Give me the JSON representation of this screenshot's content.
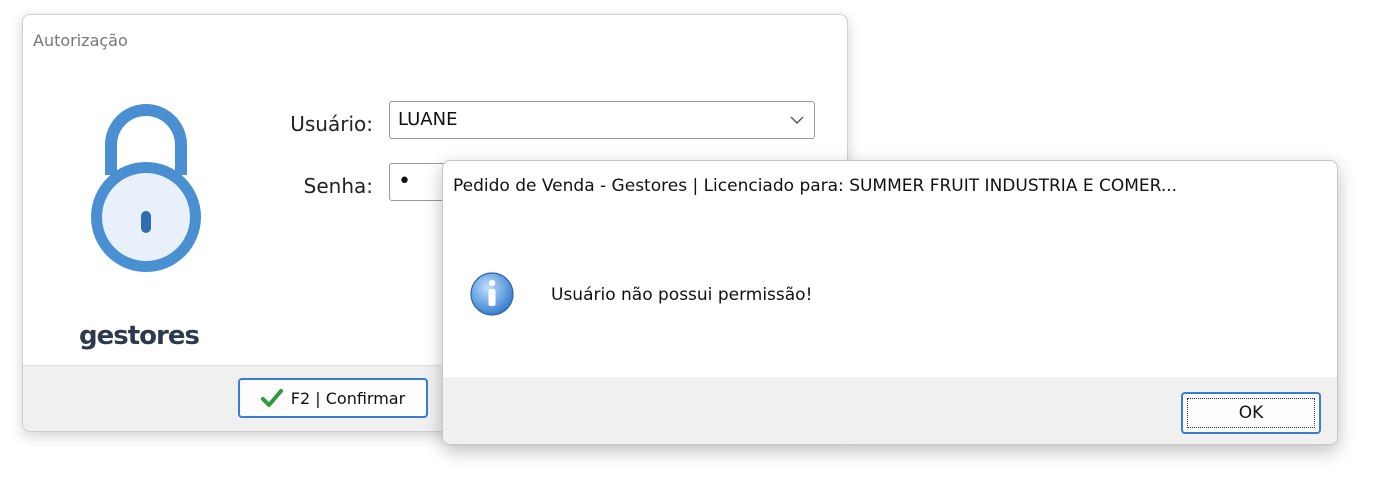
{
  "auth_window": {
    "title": "Autorização",
    "user_label": "Usuário:",
    "user_value": "LUANE",
    "password_label": "Senha:",
    "password_mask": "•",
    "brand": "gestores",
    "confirm_button": "F2 | Confirmar",
    "icons": {
      "lock": "lock-icon",
      "check": "check-icon",
      "dropdown": "chevron-down-icon"
    }
  },
  "message_dialog": {
    "title": "Pedido de Venda - Gestores | Licenciado para: SUMMER FRUIT INDUSTRIA E COMER...",
    "message": "Usuário não possui permissão!",
    "ok_button": "OK",
    "icon": "info-icon"
  },
  "colors": {
    "accent": "#3a7bd5",
    "lock_blue": "#4a8fd1",
    "check_green": "#2e9b3a",
    "footer_bg": "#f0f0f0"
  }
}
